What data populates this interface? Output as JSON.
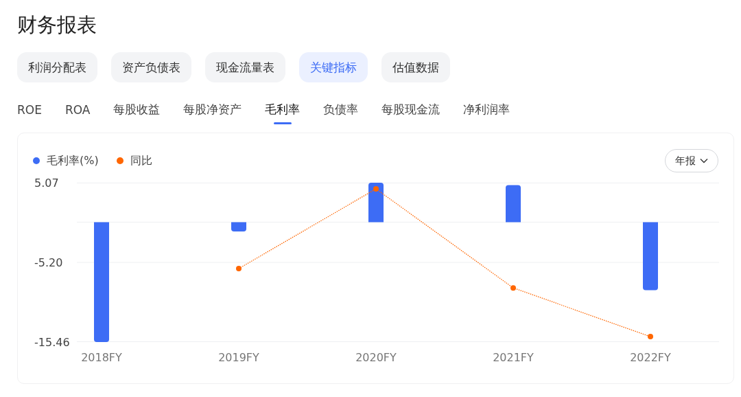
{
  "title": "财务报表",
  "report_tabs": [
    {
      "label": "利润分配表",
      "selected": false
    },
    {
      "label": "资产负债表",
      "selected": false
    },
    {
      "label": "现金流量表",
      "selected": false
    },
    {
      "label": "关键指标",
      "selected": true
    },
    {
      "label": "估值数据",
      "selected": false
    }
  ],
  "metric_tabs": [
    {
      "label": "ROE",
      "selected": false
    },
    {
      "label": "ROA",
      "selected": false
    },
    {
      "label": "每股收益",
      "selected": false
    },
    {
      "label": "每股净资产",
      "selected": false
    },
    {
      "label": "毛利率",
      "selected": true
    },
    {
      "label": "负债率",
      "selected": false
    },
    {
      "label": "每股现金流",
      "selected": false
    },
    {
      "label": "净利润率",
      "selected": false
    }
  ],
  "period_dropdown": {
    "value": "年报"
  },
  "chart_data": {
    "type": "bar",
    "categories": [
      "2018FY",
      "2019FY",
      "2020FY",
      "2021FY",
      "2022FY"
    ],
    "series": [
      {
        "name": "毛利率(%)",
        "color": "#3d6cf5",
        "values": [
          -15.5,
          -1.2,
          5.1,
          4.8,
          -8.8
        ]
      },
      {
        "name": "同比",
        "color": "#ff6600",
        "type": "line",
        "line_style": "dotted",
        "marker": "circle",
        "values": [
          null,
          -6.0,
          4.3,
          -8.5,
          -14.8
        ]
      }
    ],
    "ylim": [
      -15.5,
      5.1
    ],
    "yticks": [
      {
        "value": 5.07,
        "label": "5.07"
      },
      {
        "value": -5.2,
        "label": "-5.20"
      },
      {
        "value": -15.46,
        "label": "-15.46"
      }
    ]
  }
}
